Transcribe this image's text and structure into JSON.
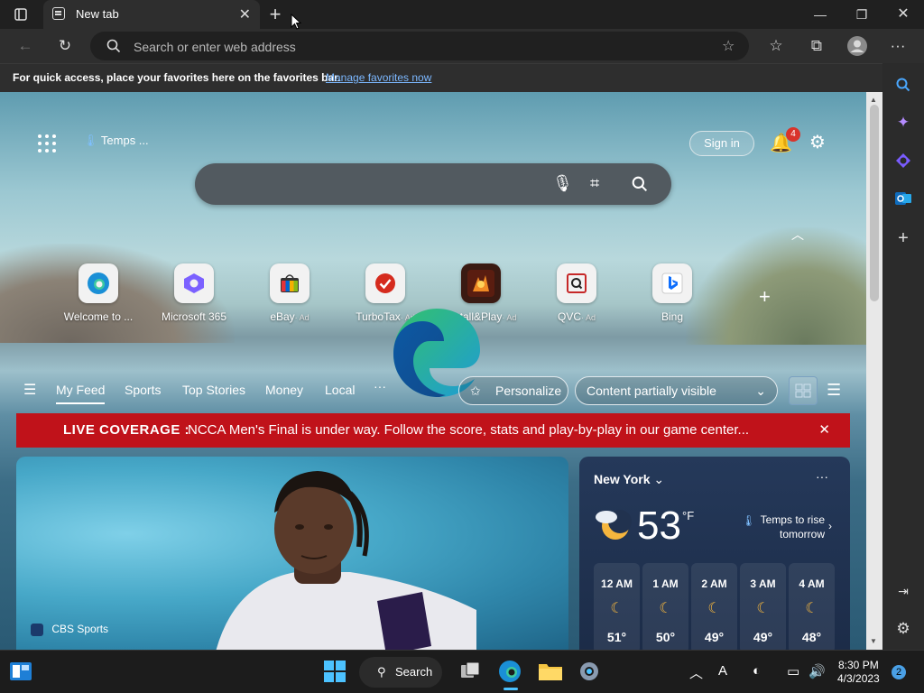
{
  "browser": {
    "tab_title": "New tab",
    "address_placeholder": "Search or enter web address"
  },
  "favorites_bar": {
    "message": "For quick access, place your favorites here on the favorites bar.",
    "link": "Manage favorites now"
  },
  "page_top": {
    "weather_pill": "Temps ...",
    "sign_in": "Sign in",
    "notification_count": "4"
  },
  "quick_links": [
    {
      "label": "Welcome to ...",
      "ad": "",
      "icon": "edge-icon"
    },
    {
      "label": "Microsoft 365",
      "ad": "",
      "icon": "microsoft365-icon"
    },
    {
      "label": "eBay",
      "ad": "· Ad",
      "icon": "ebay-icon"
    },
    {
      "label": "TurboTax",
      "ad": "· Ad",
      "icon": "turbotax-icon"
    },
    {
      "label": "Install&Play",
      "ad": "· Ad",
      "icon": "installplay-icon"
    },
    {
      "label": "QVC",
      "ad": "· Ad",
      "icon": "qvc-icon"
    },
    {
      "label": "Bing",
      "ad": "",
      "icon": "bing-icon"
    }
  ],
  "feed_nav": {
    "items": [
      "My Feed",
      "Sports",
      "Top Stories",
      "Money",
      "Local"
    ],
    "more": "···",
    "personalize": "Personalize",
    "content_visibility": "Content partially visible"
  },
  "live_banner": {
    "label": "LIVE COVERAGE :",
    "text": "NCCA Men's Final is under way. Follow the score, stats and play-by-play in our game center...",
    "close": "✕"
  },
  "hero": {
    "source": "CBS Sports"
  },
  "weather": {
    "city": "New York",
    "temperature": "53",
    "unit": "°F",
    "note": "Temps to rise tomorrow",
    "hours": [
      {
        "time": "12 AM",
        "temp": "51°"
      },
      {
        "time": "1 AM",
        "temp": "50°"
      },
      {
        "time": "2 AM",
        "temp": "49°"
      },
      {
        "time": "3 AM",
        "temp": "49°"
      },
      {
        "time": "4 AM",
        "temp": "48°"
      }
    ]
  },
  "taskbar": {
    "search_label": "Search",
    "time": "8:30 PM",
    "date": "4/3/2023",
    "notification_count": "2"
  },
  "colors": {
    "live_banner": "#c0121a",
    "accent_link": "#7cb8ff"
  }
}
